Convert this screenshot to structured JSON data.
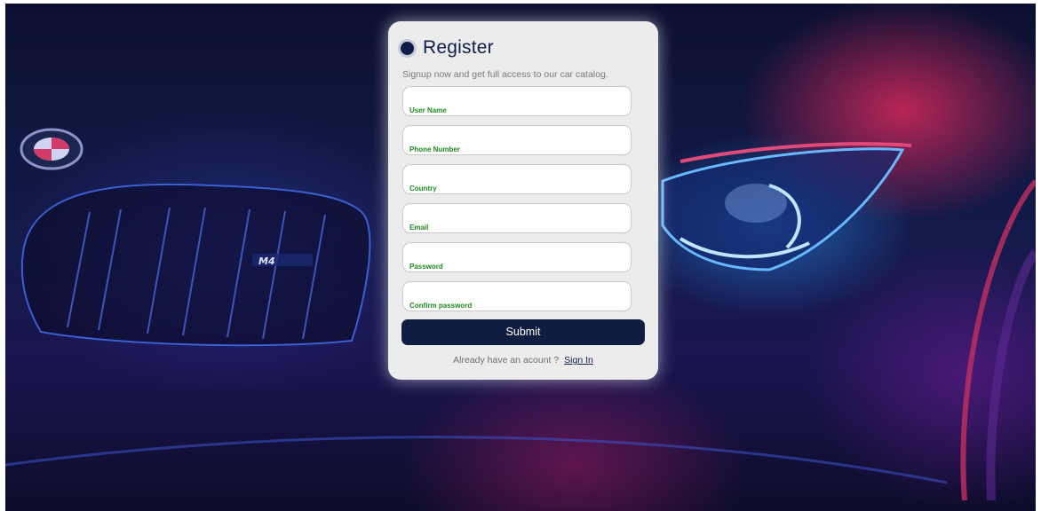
{
  "register": {
    "title": "Register",
    "subtitle": "Signup now and get full access to our car catalog.",
    "fields": [
      {
        "label": "User Name"
      },
      {
        "label": "Phone Number"
      },
      {
        "label": "Country"
      },
      {
        "label": "Email"
      },
      {
        "label": "Password"
      },
      {
        "label": "Confirm password"
      }
    ],
    "submit_label": "Submit",
    "footer_text": "Already have an acount ?",
    "signin_label": "Sign In"
  },
  "background": {
    "badge_text": "M4"
  },
  "colors": {
    "accent": "#0f1d42",
    "label_green": "#1f8a1f",
    "card_bg": "#ececec"
  }
}
